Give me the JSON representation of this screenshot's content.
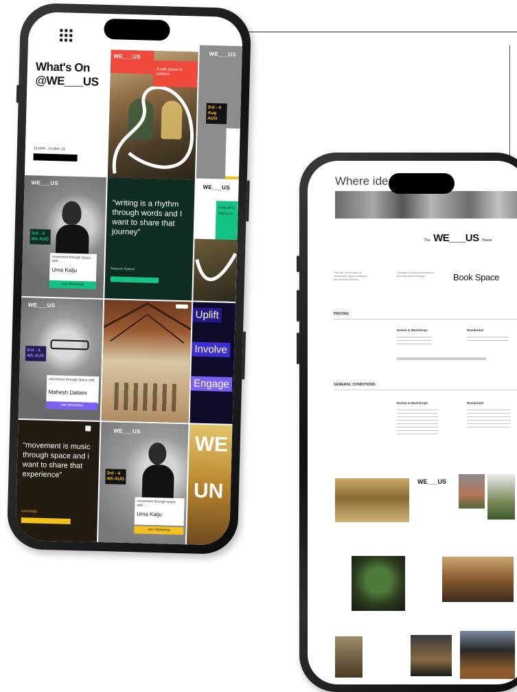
{
  "brand": "WE___US",
  "phone1": {
    "header_title_line1": "What's On",
    "header_title_line2": "@WE___US",
    "date_range": "23 APR - 23 MAY 23",
    "badge_red": "A safe space to perform",
    "date_1": "3rd - 4 Aug AUG",
    "date_2": "3rd - 4 4th AUG",
    "date_3": "3rd - 4 4th AUG",
    "date_4": "3rd - 4 4th AUG",
    "quote_1": "“writing is a rhythm through words and I want to share that journey”",
    "quote_1_author": "Mahesh Dattani",
    "quote_2": "“movement is music through space and i want to share that experience”",
    "quote_2_author": "Uma Kalju",
    "card_caption": "movement through space with ...",
    "name_uma": "Uma Kalju",
    "name_mahesh": "Mahesh Dattani",
    "cta_text": "Join Workshop",
    "words": [
      "Uplift",
      "Involve",
      "Engage"
    ],
    "side_snippet": "A wa all C Perf & Ci",
    "big_letters_1": "WE",
    "big_letters_2": "UN"
  },
  "phone2": {
    "banner_text": "Where ideas take",
    "logo_prefix": "The",
    "logo": "WE___US",
    "logo_suffix": "House",
    "book_space": "Book Space",
    "intro_text": "The We. Us house is a community space located in the old town Bandra...",
    "pricing_label": "PRICING",
    "conditions_label": "GENERAL CONDITIONS",
    "col_left_heading": "Events & Workshops",
    "col_right_heading": "Residential",
    "pricing_note": "Charges for live performances and also ticket charges...",
    "gallery_logo": "WE___US"
  },
  "colors": {
    "red": "#ef4a3b",
    "yellow": "#f4c21f",
    "green": "#14c383",
    "purple": "#7b60f2",
    "darkgreen": "#0f2c22",
    "darkbrown": "#231a10"
  }
}
